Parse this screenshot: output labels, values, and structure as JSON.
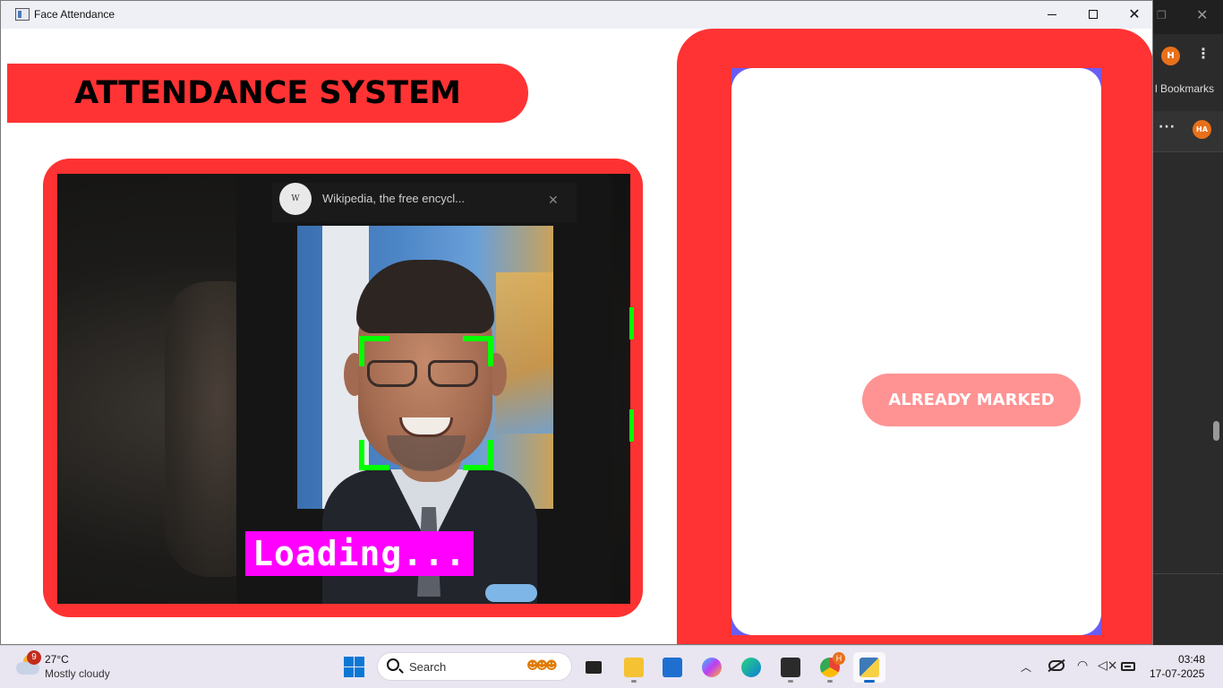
{
  "window": {
    "title": "Face Attendance",
    "minimize_icon": "minimize-icon",
    "maximize_icon": "maximize-icon",
    "close_icon": "close-icon"
  },
  "header": {
    "title": "ATTENDANCE SYSTEM"
  },
  "camera": {
    "overlay_text": "Loading...",
    "phone_tab_text": "Wikipedia, the free encycl...",
    "detection_box_color": "#00ff00",
    "overlay_bg_color": "#ff00ff"
  },
  "status": {
    "message": "ALREADY MARKED",
    "badge_color": "#ff9393"
  },
  "colors": {
    "accent_red": "#ff3334",
    "card_border": "#6b5cf6"
  },
  "background_browser": {
    "avatar_initial": "H",
    "avatar_initials_2": "HA",
    "bookmarks_label": "l Bookmarks"
  },
  "taskbar": {
    "weather_badge": "9",
    "weather_temp": "27°C",
    "weather_desc": "Mostly cloudy",
    "search_placeholder": "Search",
    "time": "03:48",
    "date": "17-07-2025",
    "chrome_badge": "H",
    "apps": [
      "task-view",
      "file-explorer",
      "microsoft-store",
      "copilot",
      "edge",
      "terminal",
      "chrome",
      "python"
    ]
  }
}
